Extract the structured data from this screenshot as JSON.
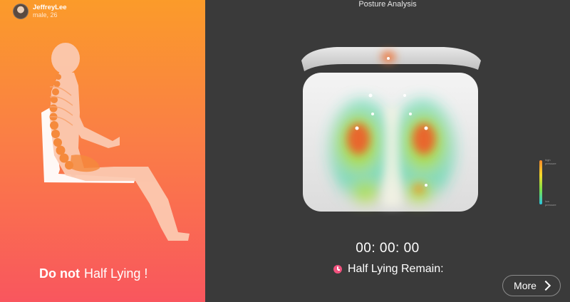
{
  "user": {
    "name": "JeffreyLee",
    "sub": "male, 26"
  },
  "warning": {
    "bold": "Do not",
    "text": "Half Lying !"
  },
  "header": {
    "title": "Posture Analysis"
  },
  "legend": {
    "high": "high pressure",
    "low": "low pressure"
  },
  "timer": {
    "value": "00: 00: 00"
  },
  "remain": {
    "label": "Half Lying Remain:"
  },
  "more": {
    "label": "More"
  },
  "colors": {
    "left_top": "#fb9b2a",
    "left_bottom": "#f9565e",
    "panel": "#3a3a3a",
    "accent": "#f1527e"
  },
  "icons": [
    "avatar",
    "posture-figure",
    "seat-heatmap",
    "clock-icon",
    "chevron-right-icon"
  ]
}
